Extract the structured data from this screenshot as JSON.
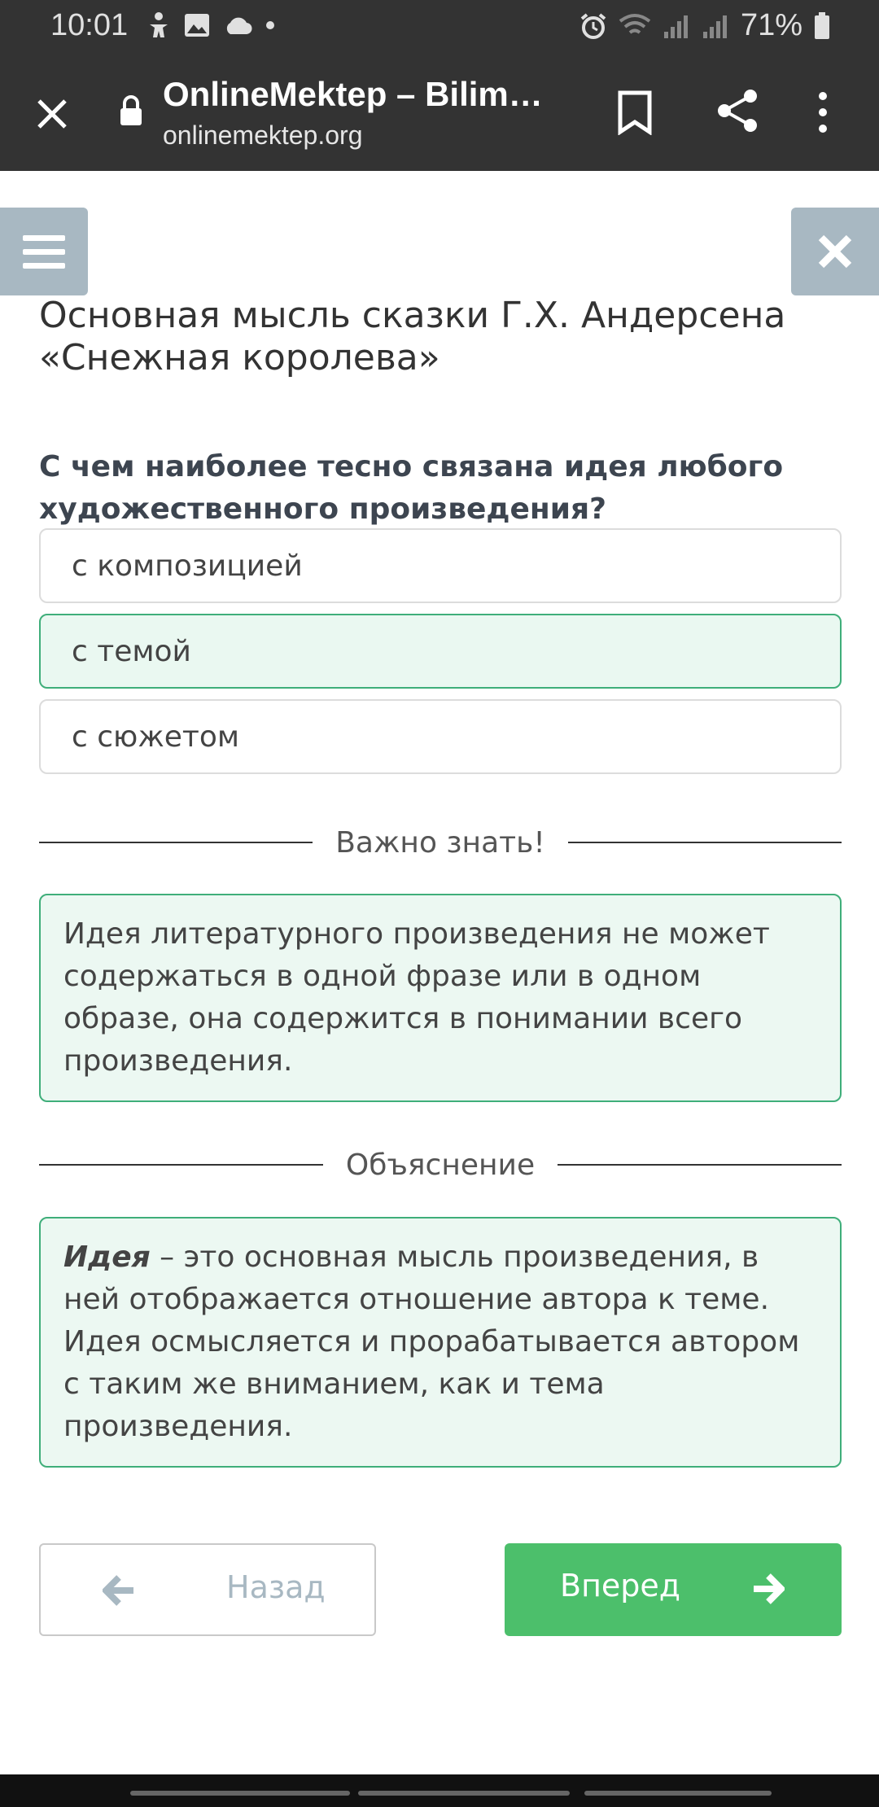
{
  "status_bar": {
    "time": "10:01",
    "battery": "71%"
  },
  "browser": {
    "title": "OnlineMektep – Bilim…",
    "url": "onlinemektep.org"
  },
  "page": {
    "title": "Основная мысль сказки Г.Х. Андерсена «Снежная королева»",
    "question": "С чем наиболее тесно связана идея любого художественного произведения?",
    "options": [
      {
        "label": "с композицией",
        "selected": false
      },
      {
        "label": "с темой",
        "selected": true
      },
      {
        "label": "с сюжетом",
        "selected": false
      }
    ],
    "important": {
      "heading": "Важно знать!",
      "text": "Идея литературного произведения не может содержаться в одной фразе или в одном образе, она содержится в понимании всего произведения."
    },
    "explanation": {
      "heading": "Объяснение",
      "term": "Идея",
      "text": " – это основная мысль произведения, в ней отображается отношение автора к теме. Идея осмысляется и прорабатывается автором с таким же вниманием, как и тема произведения."
    }
  },
  "nav": {
    "back_label": "Назад",
    "next_label": "Вперед"
  },
  "colors": {
    "accent_green": "#4cbf6b",
    "selected_border": "#3fae7a",
    "selected_bg": "#eaf8f1",
    "muted_button": "#a8b8c2"
  }
}
